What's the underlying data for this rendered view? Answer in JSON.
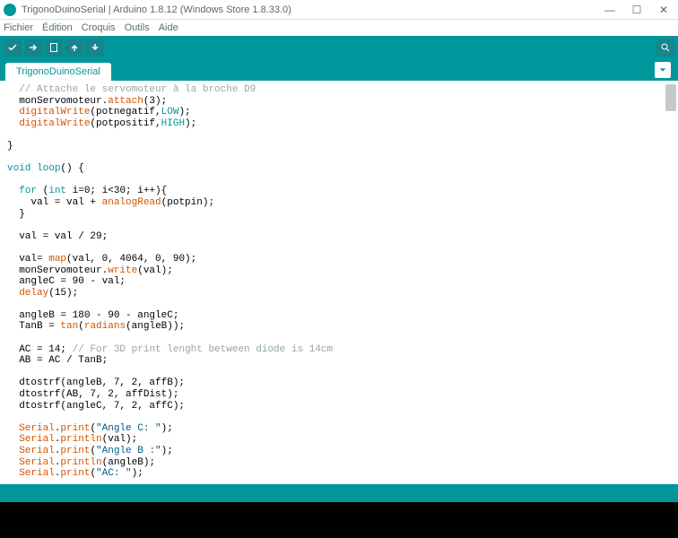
{
  "window": {
    "title": "TrigonoDuinoSerial | Arduino 1.8.12 (Windows Store 1.8.33.0)"
  },
  "menubar": {
    "items": [
      "Fichier",
      "Édition",
      "Croquis",
      "Outils",
      "Aide"
    ]
  },
  "tabs": {
    "active": "TrigonoDuinoSerial"
  },
  "code": {
    "lines": [
      {
        "indent": 1,
        "tokens": [
          {
            "t": "comment",
            "v": "// Attache le servomoteur à la broche D9"
          }
        ]
      },
      {
        "indent": 1,
        "tokens": [
          {
            "t": "plain",
            "v": "monServomoteur."
          },
          {
            "t": "func",
            "v": "attach"
          },
          {
            "t": "plain",
            "v": "(3);"
          }
        ]
      },
      {
        "indent": 1,
        "tokens": [
          {
            "t": "func",
            "v": "digitalWrite"
          },
          {
            "t": "plain",
            "v": "(potnegatif,"
          },
          {
            "t": "const",
            "v": "LOW"
          },
          {
            "t": "plain",
            "v": ");"
          }
        ]
      },
      {
        "indent": 1,
        "tokens": [
          {
            "t": "func",
            "v": "digitalWrite"
          },
          {
            "t": "plain",
            "v": "(potpositif,"
          },
          {
            "t": "const",
            "v": "HIGH"
          },
          {
            "t": "plain",
            "v": ");"
          }
        ]
      },
      {
        "indent": 0,
        "tokens": []
      },
      {
        "indent": 0,
        "tokens": [
          {
            "t": "plain",
            "v": "}"
          }
        ]
      },
      {
        "indent": 0,
        "tokens": []
      },
      {
        "indent": 0,
        "tokens": [
          {
            "t": "keyword",
            "v": "void"
          },
          {
            "t": "plain",
            "v": " "
          },
          {
            "t": "keyword",
            "v": "loop"
          },
          {
            "t": "plain",
            "v": "() {"
          }
        ]
      },
      {
        "indent": 0,
        "tokens": []
      },
      {
        "indent": 1,
        "tokens": [
          {
            "t": "keyword",
            "v": "for"
          },
          {
            "t": "plain",
            "v": " ("
          },
          {
            "t": "keyword",
            "v": "int"
          },
          {
            "t": "plain",
            "v": " i=0; i<30; i++){"
          }
        ]
      },
      {
        "indent": 2,
        "tokens": [
          {
            "t": "plain",
            "v": "val = val + "
          },
          {
            "t": "func",
            "v": "analogRead"
          },
          {
            "t": "plain",
            "v": "(potpin);"
          }
        ]
      },
      {
        "indent": 1,
        "tokens": [
          {
            "t": "plain",
            "v": "}"
          }
        ]
      },
      {
        "indent": 0,
        "tokens": []
      },
      {
        "indent": 1,
        "tokens": [
          {
            "t": "plain",
            "v": "val = val / 29;"
          }
        ]
      },
      {
        "indent": 0,
        "tokens": []
      },
      {
        "indent": 1,
        "tokens": [
          {
            "t": "plain",
            "v": "val= "
          },
          {
            "t": "func",
            "v": "map"
          },
          {
            "t": "plain",
            "v": "(val, 0, 4064, 0, 90);"
          }
        ]
      },
      {
        "indent": 1,
        "tokens": [
          {
            "t": "plain",
            "v": "monServomoteur."
          },
          {
            "t": "func",
            "v": "write"
          },
          {
            "t": "plain",
            "v": "(val);"
          }
        ]
      },
      {
        "indent": 1,
        "tokens": [
          {
            "t": "plain",
            "v": "angleC = 90 - val;"
          }
        ]
      },
      {
        "indent": 1,
        "tokens": [
          {
            "t": "func",
            "v": "delay"
          },
          {
            "t": "plain",
            "v": "(15);"
          }
        ]
      },
      {
        "indent": 0,
        "tokens": []
      },
      {
        "indent": 1,
        "tokens": [
          {
            "t": "plain",
            "v": "angleB = 180 - 90 - angleC;"
          }
        ]
      },
      {
        "indent": 1,
        "tokens": [
          {
            "t": "plain",
            "v": "TanB = "
          },
          {
            "t": "func",
            "v": "tan"
          },
          {
            "t": "plain",
            "v": "("
          },
          {
            "t": "func",
            "v": "radians"
          },
          {
            "t": "plain",
            "v": "(angleB));"
          }
        ]
      },
      {
        "indent": 0,
        "tokens": []
      },
      {
        "indent": 1,
        "tokens": [
          {
            "t": "plain",
            "v": "AC = 14; "
          },
          {
            "t": "comment",
            "v": "// For 3D print lenght between diode is 14cm"
          }
        ]
      },
      {
        "indent": 1,
        "tokens": [
          {
            "t": "plain",
            "v": "AB = AC / TanB;"
          }
        ]
      },
      {
        "indent": 0,
        "tokens": []
      },
      {
        "indent": 1,
        "tokens": [
          {
            "t": "plain",
            "v": "dtostrf(angleB, 7, 2, affB);"
          }
        ]
      },
      {
        "indent": 1,
        "tokens": [
          {
            "t": "plain",
            "v": "dtostrf(AB, 7, 2, affDist);"
          }
        ]
      },
      {
        "indent": 1,
        "tokens": [
          {
            "t": "plain",
            "v": "dtostrf(angleC, 7, 2, affC);"
          }
        ]
      },
      {
        "indent": 0,
        "tokens": []
      },
      {
        "indent": 1,
        "tokens": [
          {
            "t": "orange",
            "v": "Serial"
          },
          {
            "t": "plain",
            "v": "."
          },
          {
            "t": "func",
            "v": "print"
          },
          {
            "t": "plain",
            "v": "("
          },
          {
            "t": "string",
            "v": "\"Angle C: \""
          },
          {
            "t": "plain",
            "v": ");"
          }
        ]
      },
      {
        "indent": 1,
        "tokens": [
          {
            "t": "orange",
            "v": "Serial"
          },
          {
            "t": "plain",
            "v": "."
          },
          {
            "t": "func",
            "v": "println"
          },
          {
            "t": "plain",
            "v": "(val);"
          }
        ]
      },
      {
        "indent": 1,
        "tokens": [
          {
            "t": "orange",
            "v": "Serial"
          },
          {
            "t": "plain",
            "v": "."
          },
          {
            "t": "func",
            "v": "print"
          },
          {
            "t": "plain",
            "v": "("
          },
          {
            "t": "string",
            "v": "\"Angle B :\""
          },
          {
            "t": "plain",
            "v": ");"
          }
        ]
      },
      {
        "indent": 1,
        "tokens": [
          {
            "t": "orange",
            "v": "Serial"
          },
          {
            "t": "plain",
            "v": "."
          },
          {
            "t": "func",
            "v": "println"
          },
          {
            "t": "plain",
            "v": "(angleB);"
          }
        ]
      },
      {
        "indent": 1,
        "tokens": [
          {
            "t": "orange",
            "v": "Serial"
          },
          {
            "t": "plain",
            "v": "."
          },
          {
            "t": "func",
            "v": "print"
          },
          {
            "t": "plain",
            "v": "("
          },
          {
            "t": "string",
            "v": "\"AC: \""
          },
          {
            "t": "plain",
            "v": ");"
          }
        ]
      }
    ]
  }
}
